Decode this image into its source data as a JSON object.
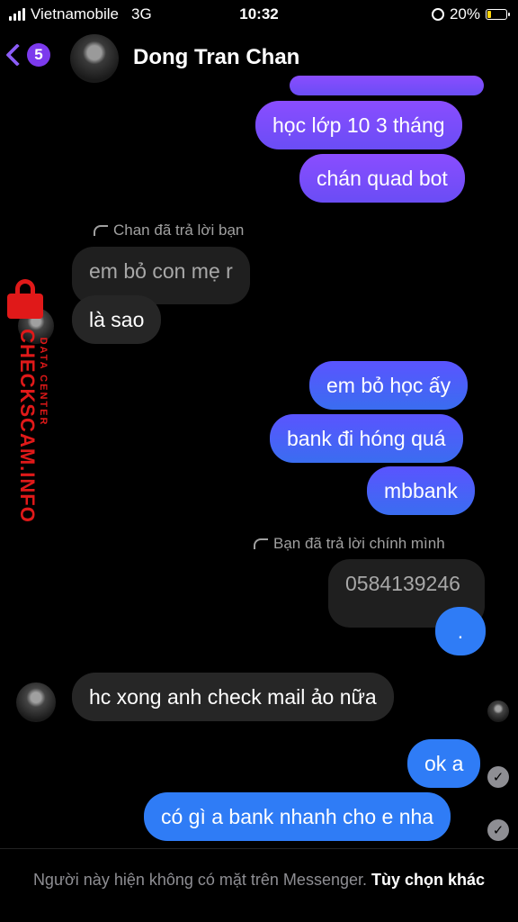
{
  "status_bar": {
    "carrier": "Vietnamobile",
    "network": "3G",
    "time": "10:32",
    "battery": "20%",
    "battery_level": 0.2,
    "icons": [
      "signal-icon",
      "rotation-lock-icon",
      "battery-charging-icon"
    ]
  },
  "header": {
    "back_count": "5",
    "name": "Dong Tran Chan",
    "accent_color": "#7c3aed"
  },
  "messages": {
    "m1": "học lớp 10 3 tháng",
    "m2": "chán quad bot",
    "reply1_hint": "Chan đã trả lời bạn",
    "quoted1": "em bỏ con mẹ r",
    "m3": "là sao",
    "m4": "em bỏ học ấy",
    "m5": "bank đi hóng quá",
    "m6": "mbbank",
    "reply2_hint": "Bạn đã trả lời chính mình",
    "quoted2": "0584139246",
    "m7": ".",
    "m8": "hc xong anh check mail ảo nữa",
    "m9": "ok a",
    "m10": "có gì a bank nhanh cho e nha"
  },
  "watermark": {
    "main": "CHECKSCAM.INFO",
    "sub": "DATA CENTER"
  },
  "footer": {
    "notice": "Người này hiện không có mặt trên Messenger.",
    "link": "Tùy chọn khác"
  },
  "colors": {
    "outgoing_purple": "#7b4dfa",
    "outgoing_blue": "#2f7cf6",
    "incoming": "#262626",
    "watermark": "#e01919"
  }
}
